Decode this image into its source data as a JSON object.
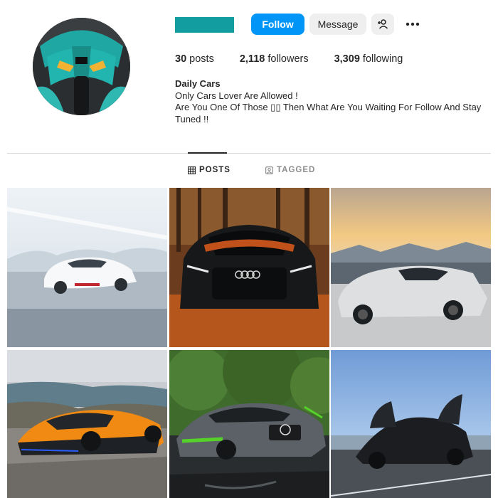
{
  "theme": {
    "accent": "#0095f6",
    "redacted_username_color": "#129ea0"
  },
  "profile": {
    "avatar_icon": "sports-motorcycle-avatar",
    "actions": {
      "follow_label": "Follow",
      "message_label": "Message",
      "add_user_icon": "add-user-icon",
      "more_icon": "more-options-icon"
    },
    "stats": {
      "posts_count": "30",
      "posts_label": "posts",
      "followers_count": "2,118",
      "followers_label": "followers",
      "following_count": "3,309",
      "following_label": "following"
    },
    "bio": {
      "name": "Daily Cars",
      "line1": "Only Cars Lover Are Allowed !",
      "line2": "Are You One Of Those ▯▯ Then What Are You Waiting For Follow And Stay Tuned !!"
    }
  },
  "tabs": [
    {
      "label": "POSTS",
      "icon": "grid-icon",
      "active": true
    },
    {
      "label": "TAGGED",
      "icon": "tagged-icon",
      "active": false
    }
  ],
  "posts": [
    {
      "subject": "white-ferrari-snow"
    },
    {
      "subject": "black-audi-autumn-leaves"
    },
    {
      "subject": "silver-ferrari-sunset"
    },
    {
      "subject": "orange-mclaren-coast"
    },
    {
      "subject": "grey-green-mercedes-amg-forest"
    },
    {
      "subject": "black-mclaren-doors-open"
    }
  ]
}
